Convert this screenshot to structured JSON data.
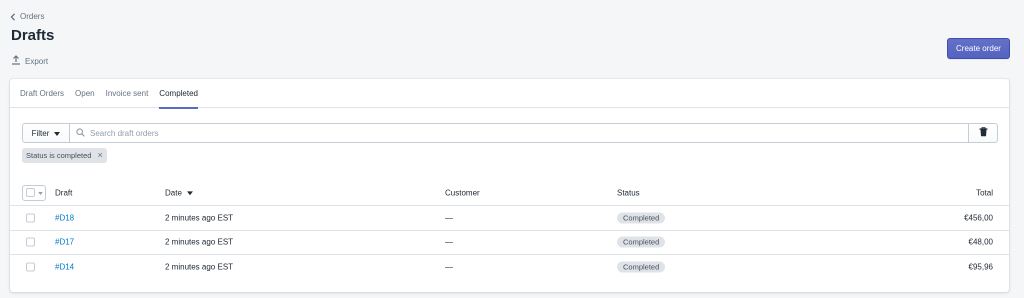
{
  "breadcrumb": {
    "label": "Orders"
  },
  "page": {
    "title": "Drafts",
    "export_label": "Export"
  },
  "actions": {
    "create_label": "Create order"
  },
  "tabs": [
    {
      "label": "Draft Orders",
      "active": false
    },
    {
      "label": "Open",
      "active": false
    },
    {
      "label": "Invoice sent",
      "active": false
    },
    {
      "label": "Completed",
      "active": true
    }
  ],
  "filter": {
    "button_label": "Filter",
    "search_placeholder": "Search draft orders",
    "search_value": "",
    "applied_tag": "Status is completed"
  },
  "table": {
    "headers": {
      "draft": "Draft",
      "date": "Date",
      "customer": "Customer",
      "status": "Status",
      "total": "Total"
    },
    "rows": [
      {
        "draft": "#D18",
        "date": "2 minutes ago EST",
        "customer": "—",
        "status": "Completed",
        "total": "€456,00"
      },
      {
        "draft": "#D17",
        "date": "2 minutes ago EST",
        "customer": "—",
        "status": "Completed",
        "total": "€48,00"
      },
      {
        "draft": "#D14",
        "date": "2 minutes ago EST",
        "customer": "—",
        "status": "Completed",
        "total": "€95,96"
      }
    ]
  },
  "colors": {
    "accent": "#5c6ac4",
    "link": "#007ace",
    "background": "#f4f6f8"
  }
}
